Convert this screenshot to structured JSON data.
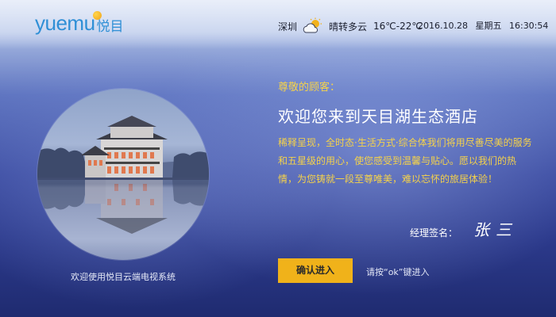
{
  "header": {
    "logo_text": "yuemu",
    "logo_cn": "悦目",
    "city": "深圳",
    "weather_icon": "partly-cloudy-icon",
    "weather_condition": "晴转多云",
    "temperature": "16℃-22℃",
    "date": "2016.10.28",
    "weekday": "星期五",
    "time": "16:30:54"
  },
  "left": {
    "welcome_system": "欢迎使用悦目云端电视系统"
  },
  "main": {
    "greeting": "尊敬的顾客：",
    "headline": "欢迎您来到天目湖生态酒店",
    "body": "稀释呈现，全时态·生活方式·综合体我们将用尽善尽美的服务和五星级的用心，使您感受到温馨与贴心。愿以我们的热情，为您铸就一段至尊唯美，难以忘怀的旅居体验！",
    "signature_label": "经理签名：",
    "signature": "张三",
    "enter_button": "确认进入",
    "hint": "请按“ok”键进入"
  },
  "colors": {
    "accent_yellow": "#f5d24a",
    "button_yellow": "#f0b21a",
    "logo_blue": "#2f8fd6"
  }
}
